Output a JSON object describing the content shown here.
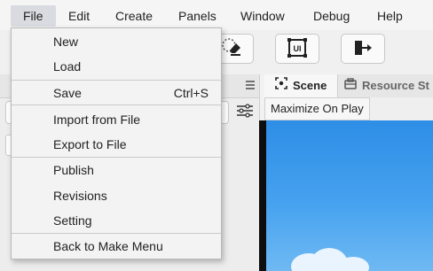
{
  "menubar": {
    "items": [
      "File",
      "Edit",
      "Create",
      "Panels",
      "Window",
      "Debug",
      "Help"
    ]
  },
  "toolbar": {
    "tools": [
      {
        "icon": "eraser-icon"
      },
      {
        "icon": "ui-frame-icon",
        "label": "UI"
      },
      {
        "icon": "exit-arrow-icon"
      }
    ]
  },
  "tabs": {
    "scene": "Scene",
    "resource": "Resource St"
  },
  "scene_toolbar": {
    "maximize": "Maximize On Play"
  },
  "file_menu": {
    "items": [
      {
        "label": "New"
      },
      {
        "label": "Load"
      },
      {
        "label": "Save",
        "shortcut": "Ctrl+S"
      },
      {
        "label": "Import from File"
      },
      {
        "label": "Export to File"
      },
      {
        "label": "Publish"
      },
      {
        "label": "Revisions"
      },
      {
        "label": "Setting"
      },
      {
        "label": "Back to Make Menu"
      }
    ]
  },
  "colors": {
    "sky_top": "#2e8ee6",
    "sky_bottom": "#6fb9f3",
    "menu_active": "#d9dbe0"
  }
}
